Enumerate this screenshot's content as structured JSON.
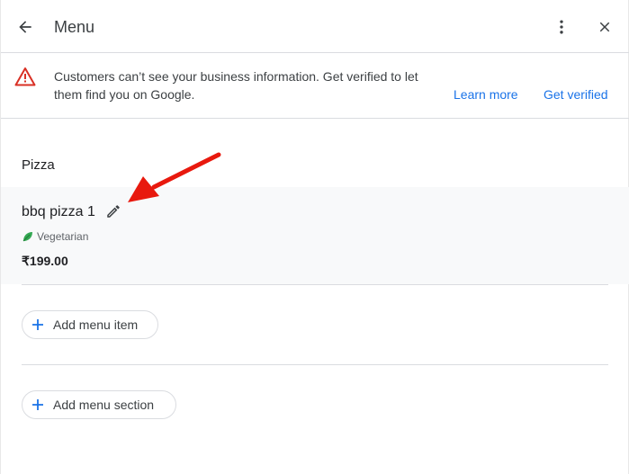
{
  "header": {
    "title": "Menu",
    "icons": {
      "back": "back-arrow-icon",
      "more": "more-vert-icon",
      "close": "close-icon"
    }
  },
  "banner": {
    "message": "Customers can’t see your business information. Get verified to let them find you on Google.",
    "learn_more": "Learn more",
    "get_verified": "Get verified",
    "icon": "warning-icon",
    "colors": {
      "warning": "#d93025",
      "link": "#1a73e8"
    }
  },
  "section": {
    "title": "Pizza",
    "item": {
      "name": "bbq pizza 1",
      "diet": "Vegetarian",
      "price": "₹199.00",
      "icons": {
        "edit": "pencil-icon",
        "diet": "leaf-icon"
      }
    },
    "add_item_label": "Add menu item"
  },
  "add_section_label": "Add menu section",
  "annotation": {
    "type": "arrow",
    "color": "#e8190e",
    "points_to": "edit-button"
  }
}
